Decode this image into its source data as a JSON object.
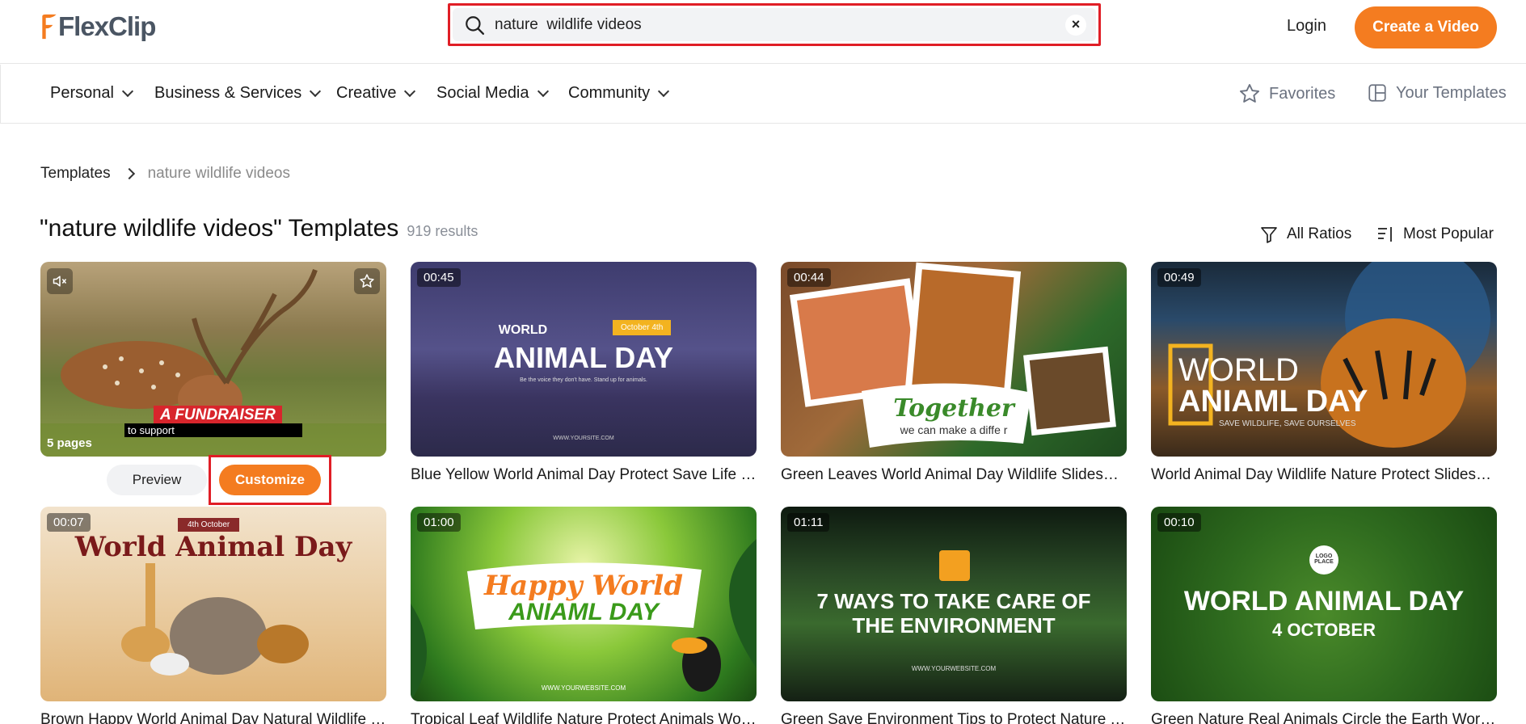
{
  "header": {
    "logo": "FlexClip",
    "search": {
      "value": "nature  wildlife videos",
      "clear": "×"
    },
    "login": "Login",
    "create": "Create a Video"
  },
  "nav": {
    "items": [
      "Personal",
      "Business & Services",
      "Creative",
      "Social Media",
      "Community"
    ],
    "favorites": "Favorites",
    "your_templates": "Your Templates"
  },
  "breadcrumb": {
    "root": "Templates",
    "current": "nature wildlife videos"
  },
  "page": {
    "title": "\"nature wildlife videos\"  Templates",
    "results": "919 results",
    "filter_ratio": "All Ratios",
    "sort": "Most Popular"
  },
  "cards": [
    {
      "title": "",
      "duration": "",
      "pages": "5 pages",
      "overlay1": "A FUNDRAISER",
      "overlay2": "to support"
    },
    {
      "title": "Blue Yellow World Animal Day Protect Save Life Wildli...",
      "duration": "00:45",
      "line1": "WORLD",
      "line2": "ANIMAL DAY",
      "tag": "October 4th",
      "sub": "Be the voice they don't have. Stand up for animals.",
      "footer": "WWW.YOURSITE.COM"
    },
    {
      "title": "Green Leaves World Animal Day Wildlife Slideshow",
      "duration": "00:44",
      "line1": "Together",
      "line2": "we can make a diffe r"
    },
    {
      "title": "World Animal Day Wildlife Nature Protect Slideshow",
      "duration": "00:49",
      "line1": "WORLD",
      "line2": "ANIAML DAY",
      "sub": "SAVE WILDLIFE, SAVE OURSELVES"
    },
    {
      "title": "Brown Happy World Animal Day Natural Wildlife Prote...",
      "duration": "00:07",
      "tag": "4th October",
      "line1": "World Animal Day"
    },
    {
      "title": "Tropical Leaf Wildlife Nature Protect Animals World S...",
      "duration": "01:00",
      "line1": "Happy World",
      "line2": "ANIAML DAY",
      "footer": "WWW.YOURWEBSITE.COM"
    },
    {
      "title": "Green Save Environment Tips to Protect Nature Trailer",
      "duration": "01:11",
      "line1": "7 WAYS TO TAKE CARE OF",
      "line2": "THE ENVIRONMENT",
      "footer": "WWW.YOURWEBSITE.COM"
    },
    {
      "title": "Green Nature Real Animals Circle the Earth World Ani...",
      "duration": "00:10",
      "tag": "LOGO PLACE",
      "line1": "WORLD ANIMAL DAY",
      "line2": "4 OCTOBER"
    }
  ],
  "card_actions": {
    "preview": "Preview",
    "customize": "Customize"
  }
}
